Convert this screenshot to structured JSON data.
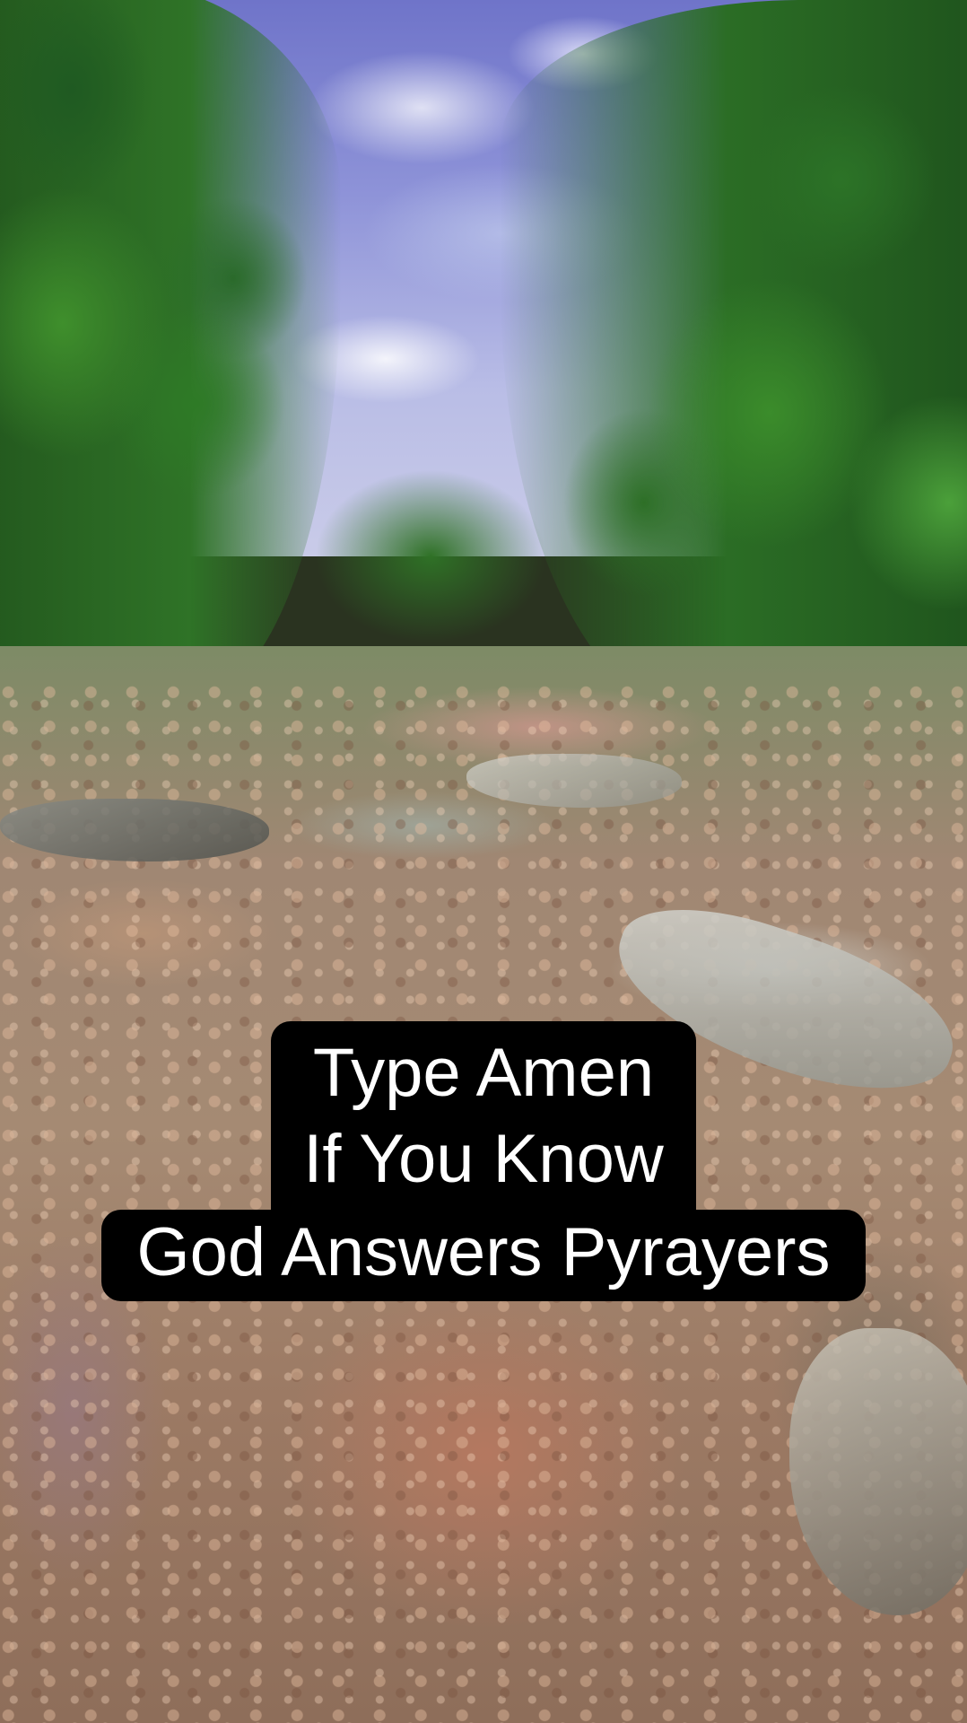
{
  "caption": {
    "lines": [
      "Type Amen",
      "If You Know",
      "God Answers Pyrayers"
    ]
  },
  "colors": {
    "caption_background": "#000000",
    "caption_text": "#ffffff"
  }
}
